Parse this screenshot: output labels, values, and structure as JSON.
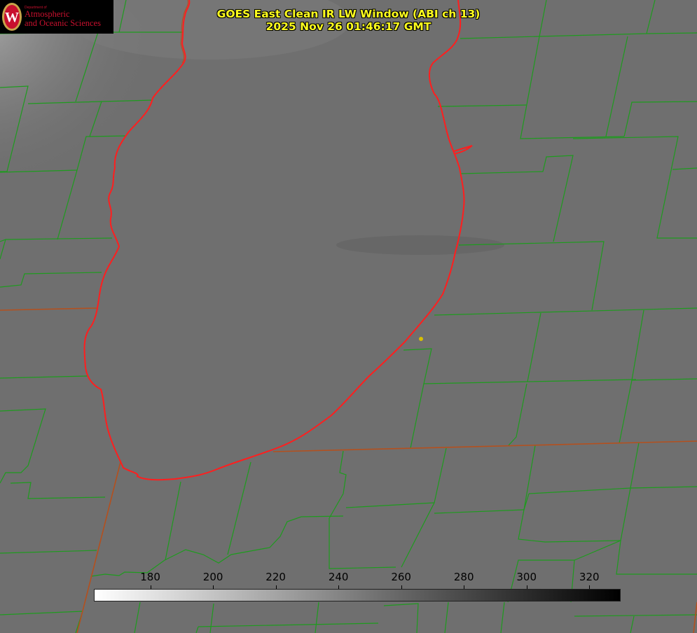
{
  "product": {
    "title": "GOES East Clean IR LW Window (ABI ch 13)",
    "timestamp": "2025 Nov 26 01:46:17 GMT"
  },
  "logo": {
    "line_small": "Department of",
    "line1": "Atmospheric",
    "line2": "and Oceanic Sciences",
    "shield_letter": "W"
  },
  "colorbar": {
    "units_hidden": true,
    "min": 162,
    "max": 330,
    "ticks": [
      {
        "label": "180",
        "value": 180
      },
      {
        "label": "200",
        "value": 200
      },
      {
        "label": "220",
        "value": 220
      },
      {
        "label": "240",
        "value": 240
      },
      {
        "label": "260",
        "value": 260
      },
      {
        "label": "280",
        "value": 280
      },
      {
        "label": "300",
        "value": 300
      },
      {
        "label": "320",
        "value": 320
      }
    ]
  },
  "colors": {
    "title_text": "#ffff1e",
    "county_lines": "#1e9b1e",
    "lake_shore": "#ff1e1e",
    "state_lines": "#b4501e",
    "marker": "#d8c000"
  }
}
